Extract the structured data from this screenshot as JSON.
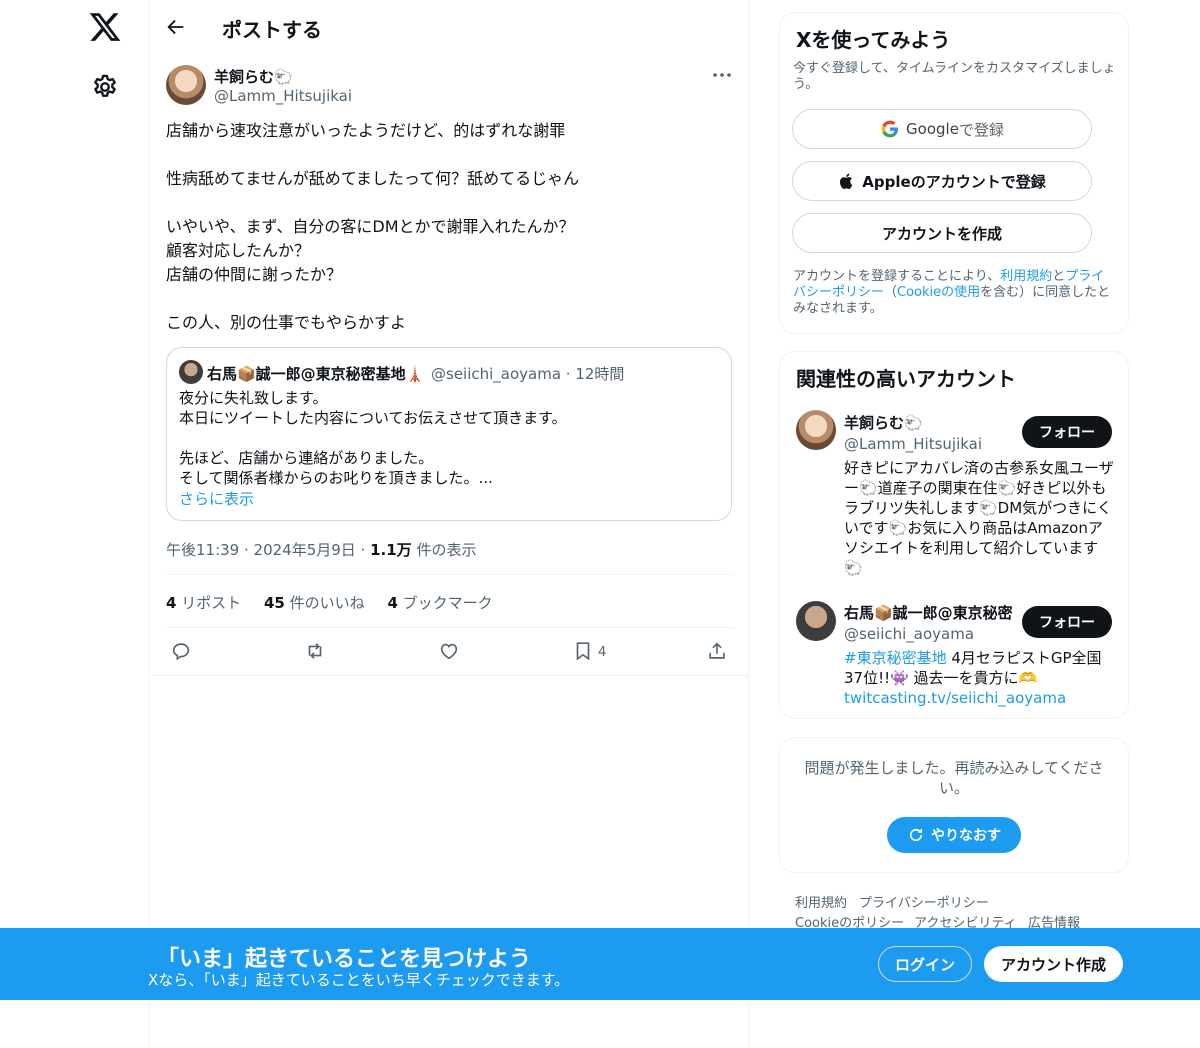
{
  "header": {
    "title": "ポストする"
  },
  "icons": [
    "x-logo-icon",
    "gear-icon",
    "back-arrow-icon",
    "more-icon",
    "reply-icon",
    "repost-icon",
    "like-icon",
    "bookmark-icon",
    "share-icon",
    "google-icon",
    "apple-icon",
    "refresh-icon"
  ],
  "colors": {
    "accent": "#1d9bf0",
    "text": "#0f1419",
    "muted": "#536471",
    "border": "#cfd9de"
  },
  "post": {
    "author_name": "羊飼らむ🐑",
    "author_handle": "@Lamm_Hitsujikai",
    "lines": [
      "店舗から速攻注意がいったようだけど、的はずれな謝罪",
      "",
      "性病舐めてませんが舐めてましたって何？舐めてるじゃん",
      "",
      "いやいや、まず、自分の客にDMとかで謝罪入れたんか？",
      "顧客対応したんか？",
      "店舗の仲間に謝ったか？",
      "",
      "この人、別の仕事でもやらかすよ"
    ],
    "quote": {
      "name": "右馬📦誠一郎@東京秘密基地🗼",
      "handle_time": "@seiichi_aoyama · 12時間",
      "lines": [
        "夜分に失礼致します。",
        "本日にツイートした内容についてお伝えさせて頂きます。",
        "",
        "先ほど、店舗から連絡がありました。",
        "そして関係者様からのお叱りを頂きました。..."
      ],
      "show_more": "さらに表示"
    },
    "time_date": "午後11:39 · 2024年5月9日 · ",
    "views_count": "1.1万",
    "views_label": " 件の表示",
    "reposts_count": "4",
    "reposts_label": " リポスト",
    "likes_count": "45",
    "likes_label": " 件のいいね",
    "bookmarks_count": "4",
    "bookmarks_label": " ブックマーク",
    "bookmark_action_count": "4"
  },
  "signup_card": {
    "title": "Xを使ってみよう",
    "subtitle": "今すぐ登録して、タイムラインをカスタマイズしましょう。",
    "google_brand": "Google",
    "google_label": " で登録",
    "apple_label": "Appleのアカウントで登録",
    "create_label": "アカウントを作成",
    "legal_pre": "アカウントを登録することにより、",
    "legal_terms": "利用規約",
    "legal_and": "と",
    "legal_privacy": "プライバシーポリシー",
    "legal_mid": "（",
    "legal_cookie": "Cookieの使用",
    "legal_post": "を含む）に同意したとみなされます。"
  },
  "related": {
    "title": "関連性の高いアカウント",
    "follow_label": "フォロー",
    "accounts": [
      {
        "name": "羊飼らむ🐑",
        "handle": "@Lamm_Hitsujikai",
        "bio": "好きピにアカバレ済の古参系女風ユーザー🐑道産子の関東在住🐑好きピ以外もラブリツ失礼します🐑DM気がつきにくいです🐑お気に入り商品はAmazonアソシエイトを利用して紹介しています🐑"
      },
      {
        "name": "右馬📦誠一郎@東京秘密",
        "handle": "@seiichi_aoyama",
        "bio_hashtag": "#東京秘密基地",
        "bio_text": " 4月セラピストGP全国37位!!👾 過去一を貴方に🫶",
        "bio_link": "twitcasting.tv/seiichi_aoyama"
      }
    ]
  },
  "error_card": {
    "message": "問題が発生しました。再読み込みしてください。",
    "retry_label": "やりなおす"
  },
  "footer": {
    "links": [
      "利用規約",
      "プライバシーポリシー",
      "Cookieのポリシー",
      "アクセシビリティ",
      "広告情報"
    ]
  },
  "banner": {
    "title": "「いま」起きていることを見つけよう",
    "subtitle": "Xなら、「いま」起きていることをいち早くチェックできます。",
    "login_label": "ログイン",
    "signup_label": "アカウント作成"
  }
}
